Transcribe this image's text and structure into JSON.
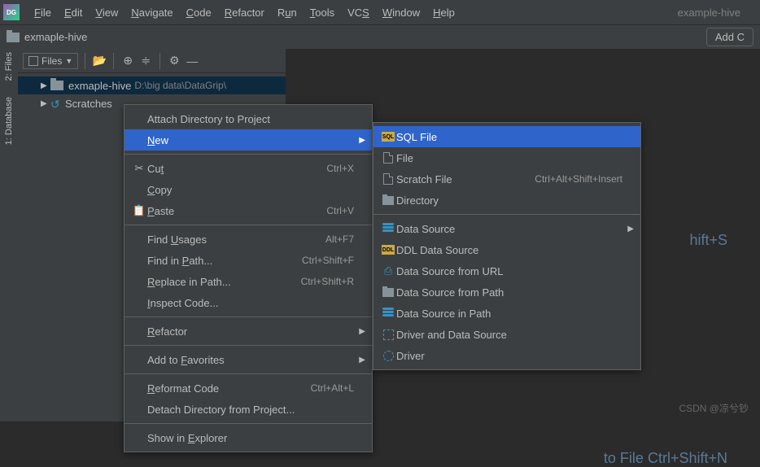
{
  "menubar": {
    "items": [
      {
        "label": "File",
        "key": "F"
      },
      {
        "label": "Edit",
        "key": "E"
      },
      {
        "label": "View",
        "key": "V"
      },
      {
        "label": "Navigate",
        "key": "N"
      },
      {
        "label": "Code",
        "key": "C"
      },
      {
        "label": "Refactor",
        "key": "R"
      },
      {
        "label": "Run",
        "key": "u"
      },
      {
        "label": "Tools",
        "key": "T"
      },
      {
        "label": "VCS",
        "key": "S"
      },
      {
        "label": "Window",
        "key": "W"
      },
      {
        "label": "Help",
        "key": "H"
      }
    ],
    "project": "example-hive"
  },
  "breadcrumb": {
    "name": "exmaple-hive",
    "add_button": "Add C"
  },
  "side_tabs": {
    "files": "2: Files",
    "database": "1: Database"
  },
  "panel": {
    "selector": "Files",
    "tree": {
      "root": {
        "name": "exmaple-hive",
        "path": "D:\\big data\\DataGrip\\"
      },
      "scratches": "Scratches"
    }
  },
  "editor_hints": {
    "h1_suffix": "hift+S",
    "h2_label": " to File ",
    "h2_key": "Ctrl+Shift+N"
  },
  "context_menu_1": {
    "items": [
      {
        "label": "Attach Directory to Project",
        "shortcut": "",
        "icon": "",
        "submenu": false,
        "sel": false
      },
      {
        "label": "New",
        "key": "N",
        "shortcut": "",
        "icon": "",
        "submenu": true,
        "sel": true
      },
      {
        "sep": true
      },
      {
        "label": "Cut",
        "key": "t",
        "prefix": "Cu",
        "shortcut": "Ctrl+X",
        "icon": "cut"
      },
      {
        "label": "Copy",
        "key": "C",
        "shortcut": "",
        "icon": ""
      },
      {
        "label": "Paste",
        "key": "P",
        "shortcut": "Ctrl+V",
        "icon": "paste"
      },
      {
        "sep": true
      },
      {
        "label": "Find Usages",
        "key": "U",
        "prefix": "Find ",
        "shortcut": "Alt+F7"
      },
      {
        "label": "Find in Path...",
        "key": "P",
        "prefix": "Find in ",
        "shortcut": "Ctrl+Shift+F"
      },
      {
        "label": "Replace in Path...",
        "key": "R",
        "shortcut": "Ctrl+Shift+R"
      },
      {
        "label": "Inspect Code...",
        "key": "I"
      },
      {
        "sep": true
      },
      {
        "label": "Refactor",
        "key": "R",
        "submenu": true
      },
      {
        "sep": true
      },
      {
        "label": "Add to Favorites",
        "key": "F",
        "prefix": "Add to ",
        "submenu": true
      },
      {
        "sep": true
      },
      {
        "label": "Reformat Code",
        "key": "R",
        "shortcut": "Ctrl+Alt+L"
      },
      {
        "label": "Detach Directory from Project..."
      },
      {
        "sep": true
      },
      {
        "label": "Show in Explorer",
        "key": "E",
        "prefix": "Show in "
      }
    ]
  },
  "context_menu_2": {
    "items": [
      {
        "label": "SQL File",
        "icon": "sql",
        "sel": true
      },
      {
        "label": "File",
        "icon": "file"
      },
      {
        "label": "Scratch File",
        "icon": "scratch",
        "shortcut": "Ctrl+Alt+Shift+Insert"
      },
      {
        "label": "Directory",
        "icon": "dir"
      },
      {
        "sep": true
      },
      {
        "label": "Data Source",
        "icon": "ds",
        "submenu": true
      },
      {
        "label": "DDL Data Source",
        "icon": "ddl"
      },
      {
        "label": "Data Source from URL",
        "icon": "url"
      },
      {
        "label": "Data Source from Path",
        "icon": "path"
      },
      {
        "label": "Data Source in Path",
        "icon": "ds"
      },
      {
        "label": "Driver and Data Source",
        "icon": "dashed"
      },
      {
        "label": "Driver",
        "icon": "dashed-circle"
      }
    ]
  },
  "watermark": "CSDN @凉兮钞"
}
